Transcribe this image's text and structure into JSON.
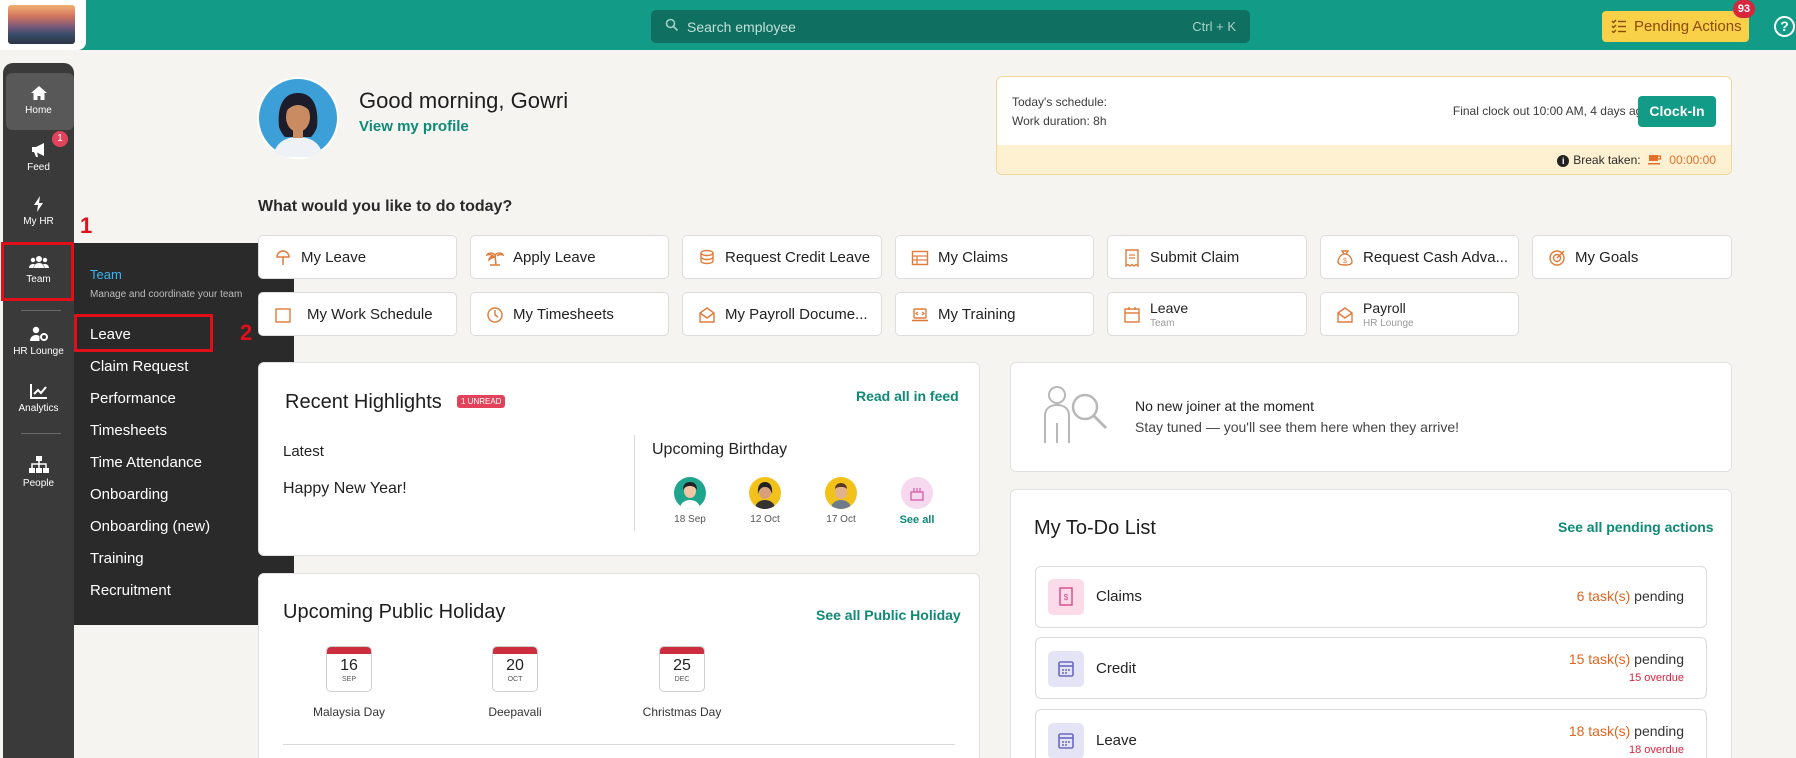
{
  "header": {
    "search_placeholder": "Search employee",
    "search_shortcut": "Ctrl + K",
    "pending_label": "Pending Actions",
    "pending_count": "93",
    "help": "?"
  },
  "sidebar": {
    "items": [
      {
        "label": "Home"
      },
      {
        "label": "Feed",
        "badge": "1"
      },
      {
        "label": "My HR"
      },
      {
        "label": "Team"
      },
      {
        "label": "HR Lounge"
      },
      {
        "label": "Analytics"
      },
      {
        "label": "People"
      }
    ]
  },
  "annotations": {
    "one": "1",
    "two": "2"
  },
  "flyout": {
    "title": "Team",
    "subtitle": "Manage and coordinate your team",
    "items": [
      "Leave",
      "Claim Request",
      "Performance",
      "Timesheets",
      "Time Attendance",
      "Onboarding",
      "Onboarding (new)",
      "Training",
      "Recruitment"
    ]
  },
  "profile": {
    "greeting": "Good morning, Gowri",
    "view_profile": "View my profile"
  },
  "schedule": {
    "today": "Today's schedule:",
    "work_duration": "Work duration: 8h",
    "final_clock": "Final clock out 10:00 AM, 4 days ago",
    "clock_in": "Clock-In",
    "break_label": "Break taken:",
    "break_value": "00:00:00"
  },
  "quick": {
    "question": "What would you like to do today?",
    "row1": [
      "My Leave",
      "Apply Leave",
      "Request Credit Leave",
      "My Claims",
      "Submit Claim",
      "Request Cash Adva...",
      "My Goals"
    ],
    "row2": [
      "My Work Schedule",
      "My Timesheets",
      "My Payroll Docume...",
      "My Training"
    ],
    "leave_team": {
      "label": "Leave",
      "sub": "Team"
    },
    "payroll_lounge": {
      "label": "Payroll",
      "sub": "HR Lounge"
    }
  },
  "highlights": {
    "title": "Recent Highlights",
    "unread": "1 UNREAD",
    "read_all": "Read all in feed",
    "latest": "Latest",
    "post": "Happy New Year!",
    "birthday_title": "Upcoming Birthday",
    "birthdays": [
      "18 Sep",
      "12 Oct",
      "17 Oct"
    ],
    "see_all": "See all"
  },
  "holiday": {
    "title": "Upcoming Public Holiday",
    "see_all": "See all Public Holiday",
    "items": [
      {
        "day": "16",
        "month": "SEP",
        "name": "Malaysia Day"
      },
      {
        "day": "20",
        "month": "OCT",
        "name": "Deepavali"
      },
      {
        "day": "25",
        "month": "DEC",
        "name": "Christmas Day"
      }
    ]
  },
  "joiner": {
    "line1": "No new joiner at the moment",
    "line2": "Stay tuned — you'll see them here when they arrive!"
  },
  "todo": {
    "title": "My To-Do List",
    "see_all": "See all pending actions",
    "items": [
      {
        "name": "Claims",
        "count": "6 task(s)",
        "suffix": " pending",
        "overdue": ""
      },
      {
        "name": "Credit",
        "count": "15 task(s)",
        "suffix": " pending",
        "overdue": "15 overdue"
      },
      {
        "name": "Leave",
        "count": "18 task(s)",
        "suffix": " pending",
        "overdue": "18 overdue"
      }
    ]
  },
  "colors": {
    "brand": "#129b86",
    "accent": "#f8d148",
    "danger": "#d7263d",
    "orange": "#e07b39"
  }
}
